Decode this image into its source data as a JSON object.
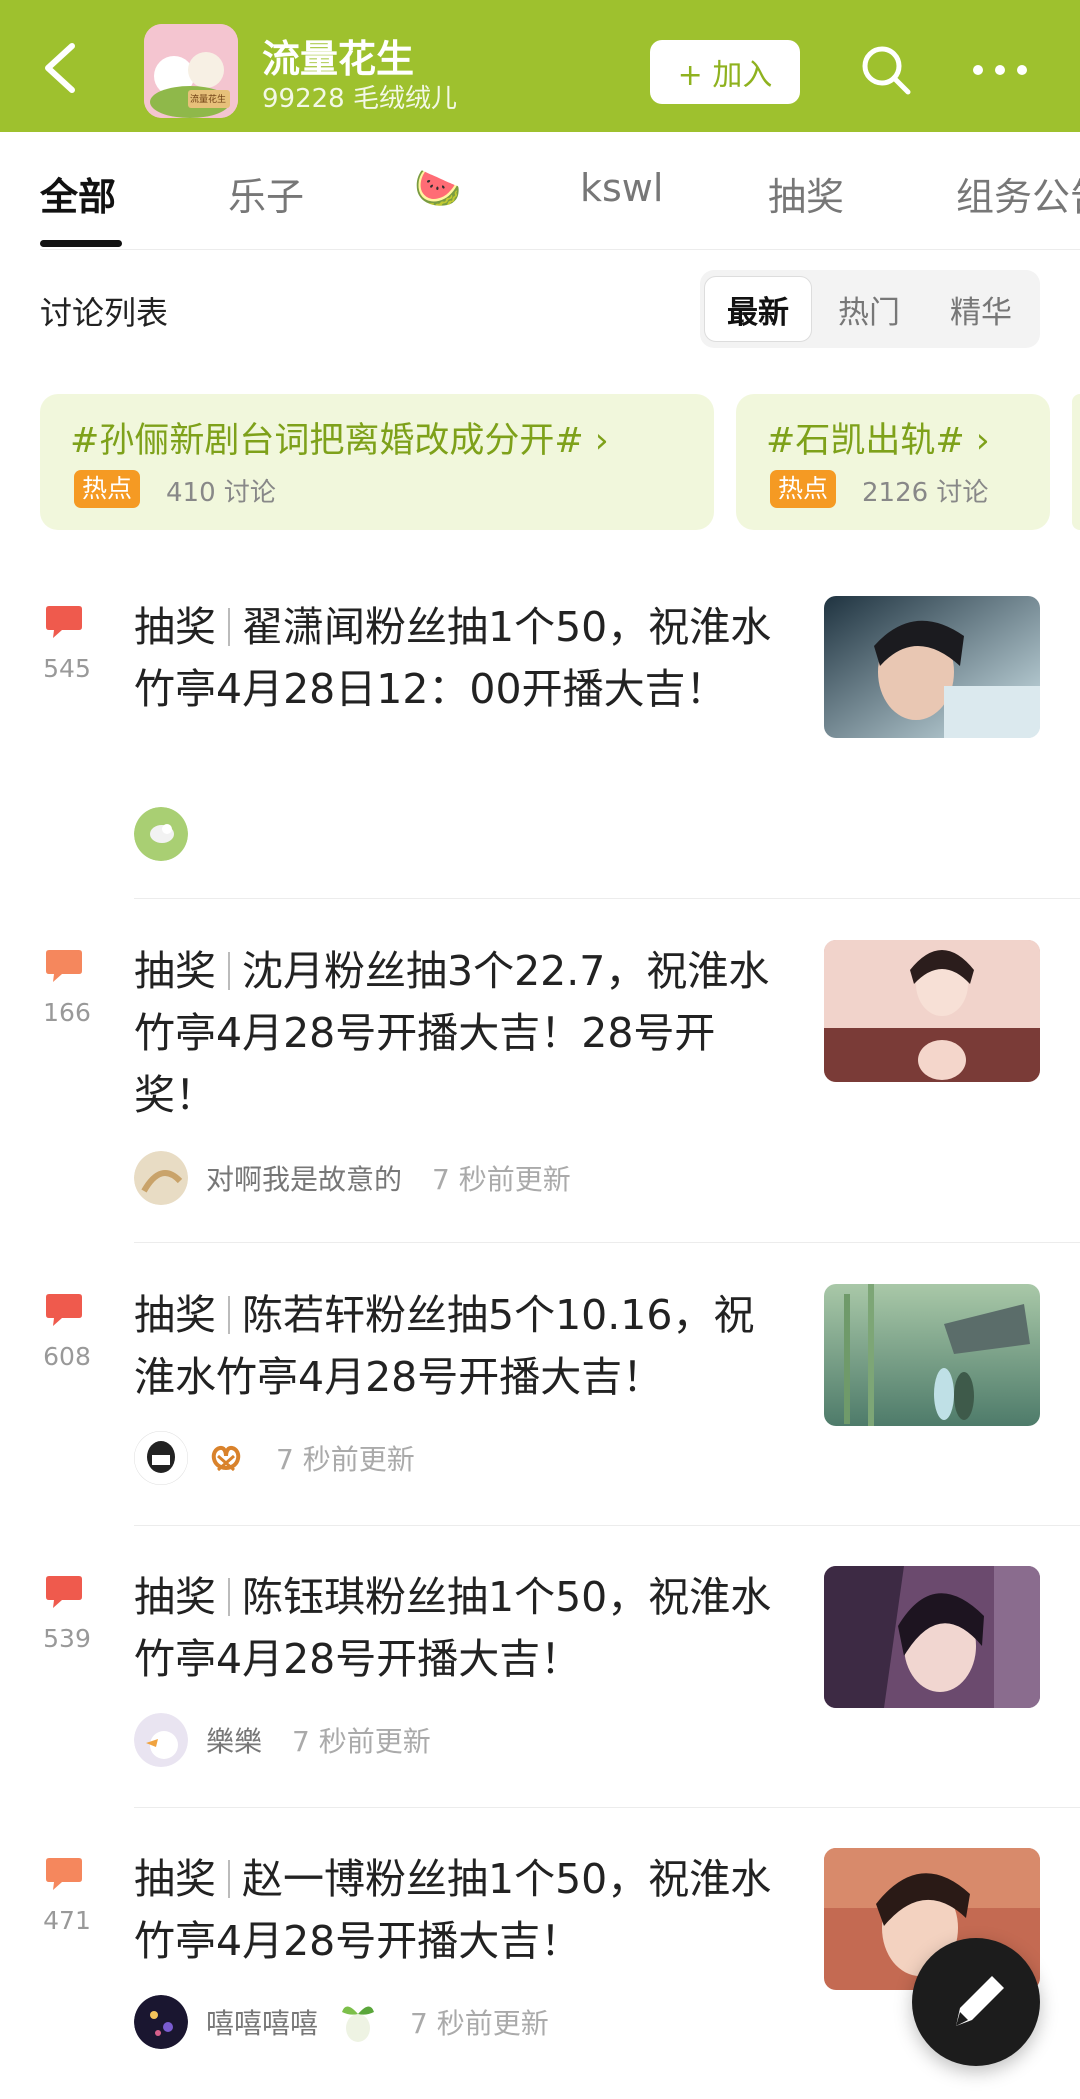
{
  "header": {
    "group_name": "流量花生",
    "group_sub": "99228 毛绒绒儿",
    "join_label": "+ 加入",
    "avatar_text": "流量花生",
    "accent": "#9ec12e"
  },
  "tabs": [
    {
      "label": "全部"
    },
    {
      "label": "乐子"
    },
    {
      "label": "🍉"
    },
    {
      "label": "kswl"
    },
    {
      "label": "抽奖"
    },
    {
      "label": "组务公告"
    }
  ],
  "discussion": {
    "label": "讨论列表",
    "sort": [
      "最新",
      "热门",
      "精华"
    ]
  },
  "topics": [
    {
      "title": "#孙俪新剧台词把离婚改成分开# ›",
      "badge": "热点",
      "count": "410 讨论"
    },
    {
      "title": "#石凯出轨# ›",
      "badge": "热点",
      "count": "2126 讨论"
    }
  ],
  "posts": [
    {
      "count": "545",
      "tag": "抽奖",
      "title": "翟潇闻粉丝抽1个50，祝淮水竹亭4月28日12：00开播大吉！",
      "user": "",
      "time": "",
      "icon_color": "#ef5a4d"
    },
    {
      "count": "166",
      "tag": "抽奖",
      "title": "沈月粉丝抽3个22.7，祝淮水竹亭4月28号开播大吉！28号开奖！",
      "user": "对啊我是故意的",
      "time": "7 秒前更新",
      "icon_color": "#f5875d"
    },
    {
      "count": "608",
      "tag": "抽奖",
      "title": "陈若轩粉丝抽5个10.16，祝淮水竹亭4月28号开播大吉！",
      "user": "",
      "time": "7 秒前更新",
      "icon_color": "#ef5a4d"
    },
    {
      "count": "539",
      "tag": "抽奖",
      "title": "陈钰琪粉丝抽1个50，祝淮水竹亭4月28号开播大吉！",
      "user": "樂樂",
      "time": "7 秒前更新",
      "icon_color": "#ef5a4d"
    },
    {
      "count": "471",
      "tag": "抽奖",
      "title": "赵一博粉丝抽1个50，祝淮水竹亭4月28号开播大吉！",
      "user": "嘻嘻嘻嘻",
      "time": "7 秒前更新",
      "icon_color": "#f5875d"
    }
  ]
}
